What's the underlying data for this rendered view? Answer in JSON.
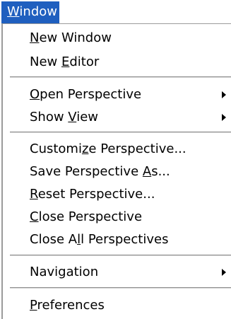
{
  "menubar": {
    "title": {
      "pre": "",
      "mn": "W",
      "post": "indow"
    }
  },
  "menu": {
    "new_window": {
      "pre": "",
      "mn": "N",
      "post": "ew Window"
    },
    "new_editor": {
      "pre": "New ",
      "mn": "E",
      "post": "ditor"
    },
    "open_perspective": {
      "pre": "",
      "mn": "O",
      "post": "pen Perspective"
    },
    "show_view": {
      "pre": "Show ",
      "mn": "V",
      "post": "iew"
    },
    "customize": {
      "pre": "Customi",
      "mn": "z",
      "post": "e Perspective..."
    },
    "save_as": {
      "pre": "Save Perspective ",
      "mn": "A",
      "post": "s..."
    },
    "reset": {
      "pre": "",
      "mn": "R",
      "post": "eset Perspective..."
    },
    "close": {
      "pre": "",
      "mn": "C",
      "post": "lose Perspective"
    },
    "close_all": {
      "pre": "Close A",
      "mn": "l",
      "post": "l Perspectives"
    },
    "navigation": {
      "pre": "Navi",
      "mn": "g",
      "post": "ation"
    },
    "preferences": {
      "pre": "",
      "mn": "P",
      "post": "references"
    }
  },
  "icons": {
    "submenu_arrow": "chevron-right-icon"
  },
  "colors": {
    "menu_title_bg": "#1f5fbf",
    "menu_title_fg": "#ffffff",
    "menu_bg": "#ffffff",
    "text": "#000000"
  }
}
